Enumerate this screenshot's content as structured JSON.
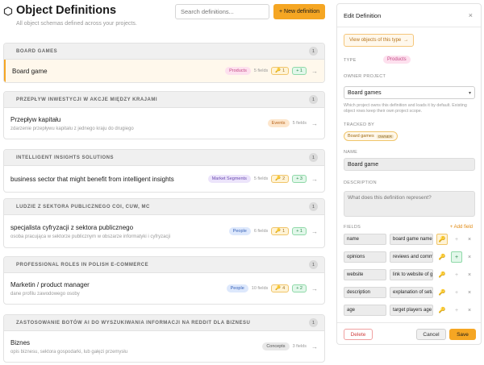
{
  "header": {
    "title": "Object Definitions",
    "subtitle": "All object schemas defined across your projects.",
    "search_placeholder": "Search definitions...",
    "new_button": "+ New definition"
  },
  "colors": {
    "accent": "#f5a623",
    "pill_products": "#fde0ee",
    "pill_events": "#fde6cc",
    "pill_segments": "#ece4fb",
    "pill_people": "#dde8fc",
    "pill_concepts": "#e8e8e8"
  },
  "groups": [
    {
      "name": "BOARD GAMES",
      "count": "1",
      "item": {
        "name": "Board game",
        "desc": "",
        "type": "Products",
        "fields": "5 fields",
        "key": "1",
        "plus": "+ 1",
        "selected": true
      }
    },
    {
      "name": "PRZEPŁYW INWESTYCJI W AKCJE MIĘDZY KRAJAMI",
      "count": "1",
      "item": {
        "name": "Przepływ kapitału",
        "desc": "zdarzenie przepływu kapitału z jednego kraju do drugiego",
        "type": "Events",
        "fields": "5 fields",
        "key": "",
        "plus": ""
      }
    },
    {
      "name": "INTELLIGENT INSIGHTS SOLUTIONS",
      "count": "1",
      "item": {
        "name": "business sector that might benefit from intelligent insights",
        "desc": "",
        "type": "Market Segments",
        "fields": "5 fields",
        "key": "2",
        "plus": "+ 3"
      }
    },
    {
      "name": "LUDZIE Z SEKTORA PUBLICZNEGO COI, CUW, MC",
      "count": "1",
      "item": {
        "name": "specjalista cyfryzacji z sektora publicznego",
        "desc": "osoba pracująca w sektorze publicznym w obszarze informatyki i cyfryzacji",
        "type": "People",
        "fields": "6 fields",
        "key": "1",
        "plus": "+ 1"
      }
    },
    {
      "name": "PROFESSIONAL ROLES IN POLISH E-COMMERCE",
      "count": "1",
      "item": {
        "name": "Marketin / product manager",
        "desc": "dane profilu zawodowego osoby",
        "type": "People",
        "fields": "10 fields",
        "key": "4",
        "plus": "+ 2"
      }
    },
    {
      "name": "ZASTOSOWANIE BOTÓW AI DO WYSZUKIWANIA INFORMACJI NA REDDIT DLA BIZNESU",
      "count": "1",
      "item": {
        "name": "Biznes",
        "desc": "opis biznesu, sektora gospodarki, lub gałęzi przemysłu",
        "type": "Concepts",
        "fields": "3 fields",
        "key": "",
        "plus": ""
      }
    }
  ],
  "panel": {
    "title": "Edit Definition",
    "close": "×",
    "view_button": "View objects of this type",
    "type_label": "TYPE",
    "type_value": "Products",
    "owner_label": "OWNER PROJECT",
    "owner_value": "Board games",
    "owner_help": "Which project owns this definition and loads it by default. Existing object rows keep their own project scope.",
    "tracked_label": "TRACKED BY",
    "tracked_project": "Board games",
    "tracked_tag": "OWNER",
    "name_label": "NAME",
    "name_value": "Board game",
    "desc_label": "DESCRIPTION",
    "desc_placeholder": "What does this definition represent?",
    "fields_label": "FIELDS",
    "add_field": "+ Add field",
    "fields": [
      {
        "name": "name",
        "desc": "board game name",
        "key_on": true,
        "plus_on": false
      },
      {
        "name": "opinions",
        "desc": "reviews and comments",
        "key_on": false,
        "plus_on": true
      },
      {
        "name": "website",
        "desc": "link to website of game",
        "key_on": false,
        "plus_on": false
      },
      {
        "name": "description",
        "desc": "explanation of setup",
        "key_on": false,
        "plus_on": false
      },
      {
        "name": "age",
        "desc": "target players age",
        "key_on": false,
        "plus_on": false
      }
    ],
    "delete": "Delete",
    "cancel": "Cancel",
    "save": "Save"
  }
}
